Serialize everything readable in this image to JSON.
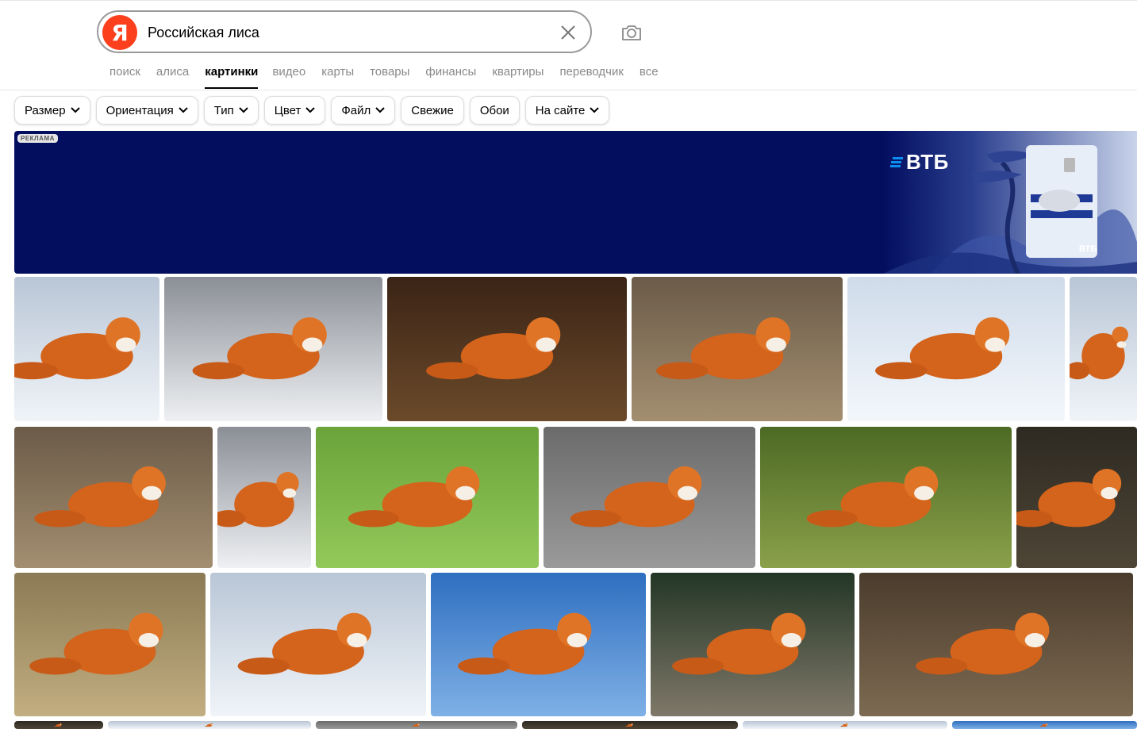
{
  "search": {
    "query": "Российская лиса",
    "logo_letter": "Я"
  },
  "nav": {
    "items": [
      {
        "label": "поиск",
        "active": false
      },
      {
        "label": "алиса",
        "active": false
      },
      {
        "label": "картинки",
        "active": true
      },
      {
        "label": "видео",
        "active": false
      },
      {
        "label": "карты",
        "active": false
      },
      {
        "label": "товары",
        "active": false
      },
      {
        "label": "финансы",
        "active": false
      },
      {
        "label": "квартиры",
        "active": false
      },
      {
        "label": "переводчик",
        "active": false
      },
      {
        "label": "все",
        "active": false
      }
    ]
  },
  "filters": [
    {
      "label": "Размер",
      "dropdown": true
    },
    {
      "label": "Ориентация",
      "dropdown": true
    },
    {
      "label": "Тип",
      "dropdown": true
    },
    {
      "label": "Цвет",
      "dropdown": true
    },
    {
      "label": "Файл",
      "dropdown": true
    },
    {
      "label": "Свежие",
      "dropdown": false
    },
    {
      "label": "Обои",
      "dropdown": false
    },
    {
      "label": "На сайте",
      "dropdown": true
    }
  ],
  "ad": {
    "label": "РЕКЛАМА",
    "brand": "ВТБ",
    "card_brand": "ВТБ",
    "background_color": "#030e5f"
  },
  "images": {
    "count": 23,
    "subject": "fox"
  },
  "colors": {
    "logo_red": "#fc3f1d",
    "nav_inactive": "#8a8a8a",
    "nav_active": "#000000"
  }
}
